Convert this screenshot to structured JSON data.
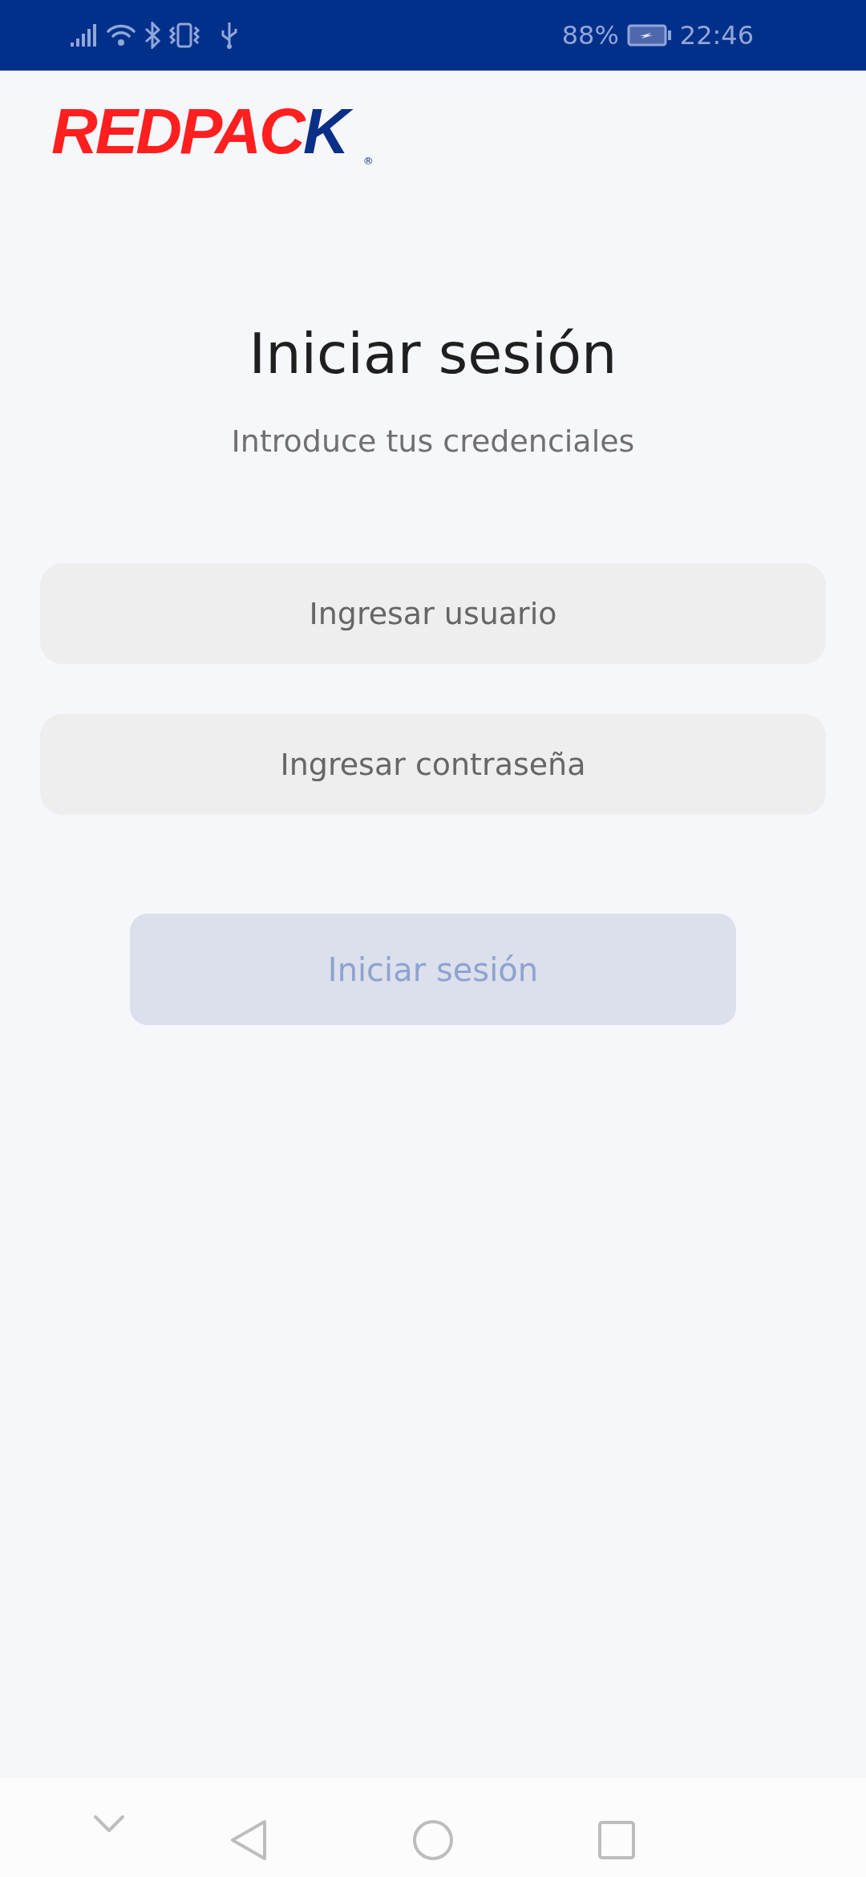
{
  "status_bar": {
    "battery_percent": "88%",
    "time": "22:46"
  },
  "logo": {
    "parts": [
      {
        "text": "REDPAC",
        "color": "#ff1f1f"
      },
      {
        "text": "K",
        "color": "#0a2f86"
      }
    ],
    "registered_mark": "®"
  },
  "title": "Iniciar sesión",
  "subtitle": "Introduce tus credenciales",
  "fields": [
    {
      "placeholder": "Ingresar usuario"
    },
    {
      "placeholder": "Ingresar contraseña"
    }
  ],
  "login_button": {
    "label": "Iniciar sesión",
    "disabled": true
  }
}
